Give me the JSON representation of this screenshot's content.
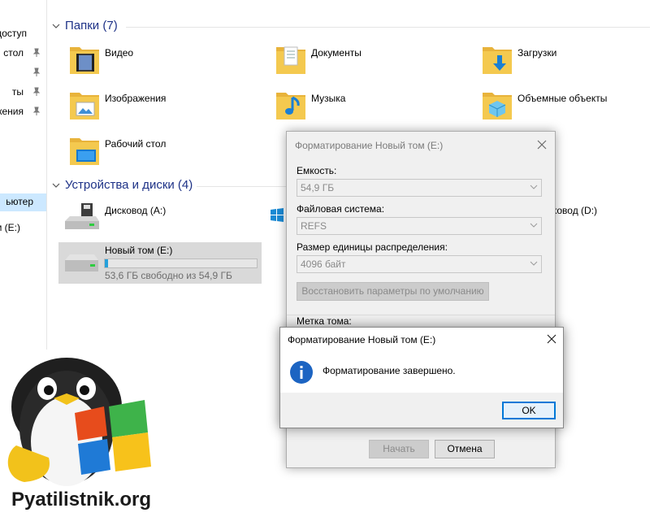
{
  "nav": {
    "items": [
      {
        "label": "доступ",
        "pinned": false
      },
      {
        "label": "стол",
        "pinned": true
      },
      {
        "label": "",
        "pinned": true
      },
      {
        "label": "ты",
        "pinned": true
      },
      {
        "label": "жения",
        "pinned": true
      },
      {
        "label": "ьютер",
        "pinned": false,
        "selected": true
      },
      {
        "label": "м (E:)",
        "pinned": false
      }
    ]
  },
  "folders_section": {
    "title": "Папки (7)",
    "items": [
      {
        "label": "Видео",
        "icon": "video-folder-icon"
      },
      {
        "label": "Документы",
        "icon": "documents-folder-icon"
      },
      {
        "label": "Загрузки",
        "icon": "downloads-folder-icon"
      },
      {
        "label": "Изображения",
        "icon": "pictures-folder-icon"
      },
      {
        "label": "Музыка",
        "icon": "music-folder-icon"
      },
      {
        "label": "Объемные объекты",
        "icon": "3d-objects-folder-icon"
      },
      {
        "label": "Рабочий стол",
        "icon": "desktop-folder-icon"
      }
    ]
  },
  "devices_section": {
    "title": "Устройства и диски (4)",
    "drives": [
      {
        "label": "Дисковод (A:)",
        "icon": "floppy-drive-icon"
      },
      {
        "label": "ковод (D:)",
        "icon": "optical-drive-icon"
      },
      {
        "label": "Новый том (E:)",
        "sub": "53,6 ГБ свободно из 54,9 ГБ",
        "used_fraction": 0.024,
        "icon": "hard-drive-icon"
      }
    ]
  },
  "format_dialog": {
    "title": "Форматирование Новый том (E:)",
    "capacity_label": "Емкость:",
    "capacity_value": "54,9 ГБ",
    "fs_label": "Файловая система:",
    "fs_value": "REFS",
    "unit_label": "Размер единицы распределения:",
    "unit_value": "4096 байт",
    "restore_label": "Восстановить параметры по умолчанию",
    "volume_label": "Метка тома:",
    "start_label": "Начать",
    "cancel_label": "Отмена"
  },
  "message_box": {
    "title": "Форматирование Новый том (E:)",
    "text": "Форматирование завершено.",
    "ok_label": "OK"
  },
  "watermark": {
    "text": "Pyatilistnik.org"
  },
  "colors": {
    "accent": "#0078d7",
    "header_text": "#1e3287",
    "selection": "#cce8ff",
    "folder_yellow": "#f4c94f"
  }
}
